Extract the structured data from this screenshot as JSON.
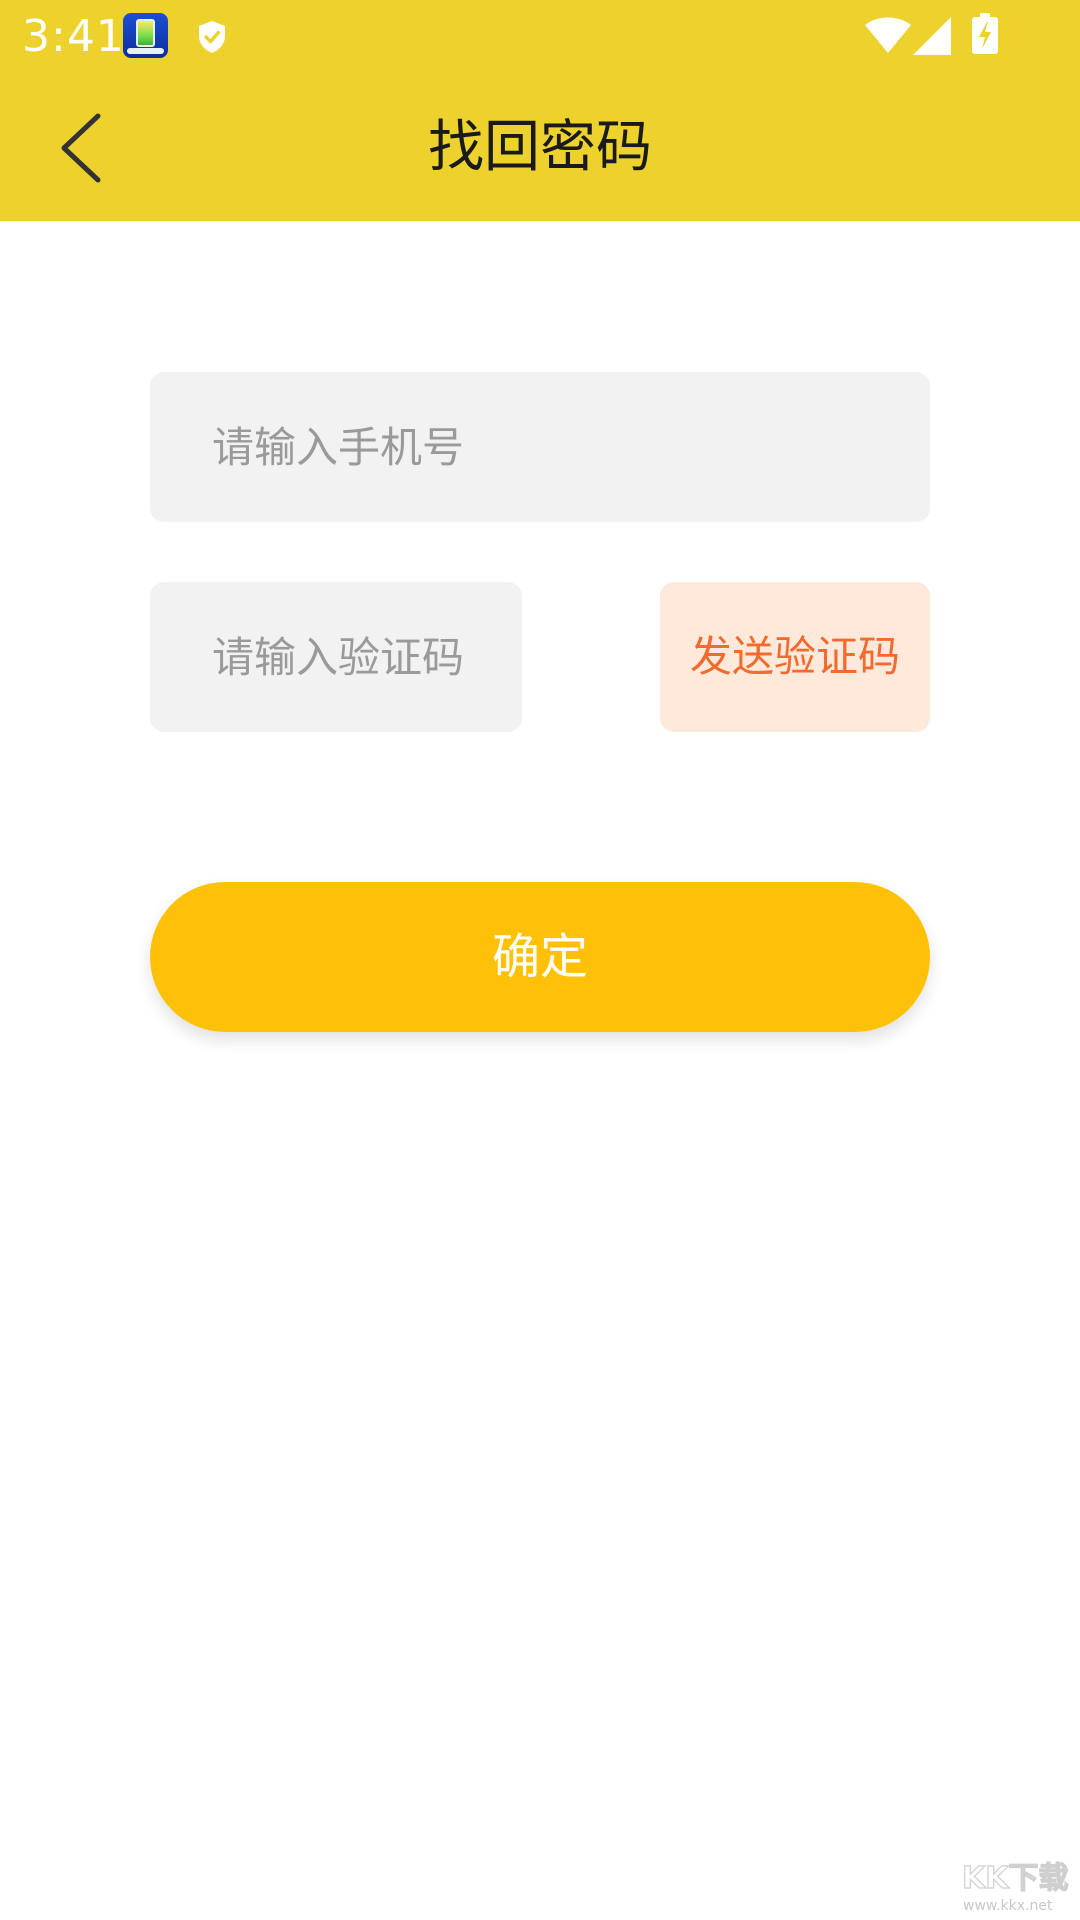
{
  "status_bar": {
    "time": "3:41",
    "icons": [
      "app-battery-icon",
      "shield-check-icon",
      "wifi-icon",
      "cellular-signal-icon",
      "battery-charging-icon"
    ]
  },
  "header": {
    "title": "找回密码",
    "back_icon": "chevron-left-icon"
  },
  "form": {
    "phone_placeholder": "请输入手机号",
    "code_placeholder": "请输入验证码",
    "send_code_label": "发送验证码",
    "confirm_label": "确定"
  },
  "watermark": {
    "logo_text": "KK下载",
    "url": "www.kkx.net"
  },
  "colors": {
    "header_background": "#EDD22E",
    "input_background": "#F2F2F2",
    "send_code_background": "#FFE9DA",
    "send_code_text": "#F26A2E",
    "confirm_background": "#FFC107"
  }
}
